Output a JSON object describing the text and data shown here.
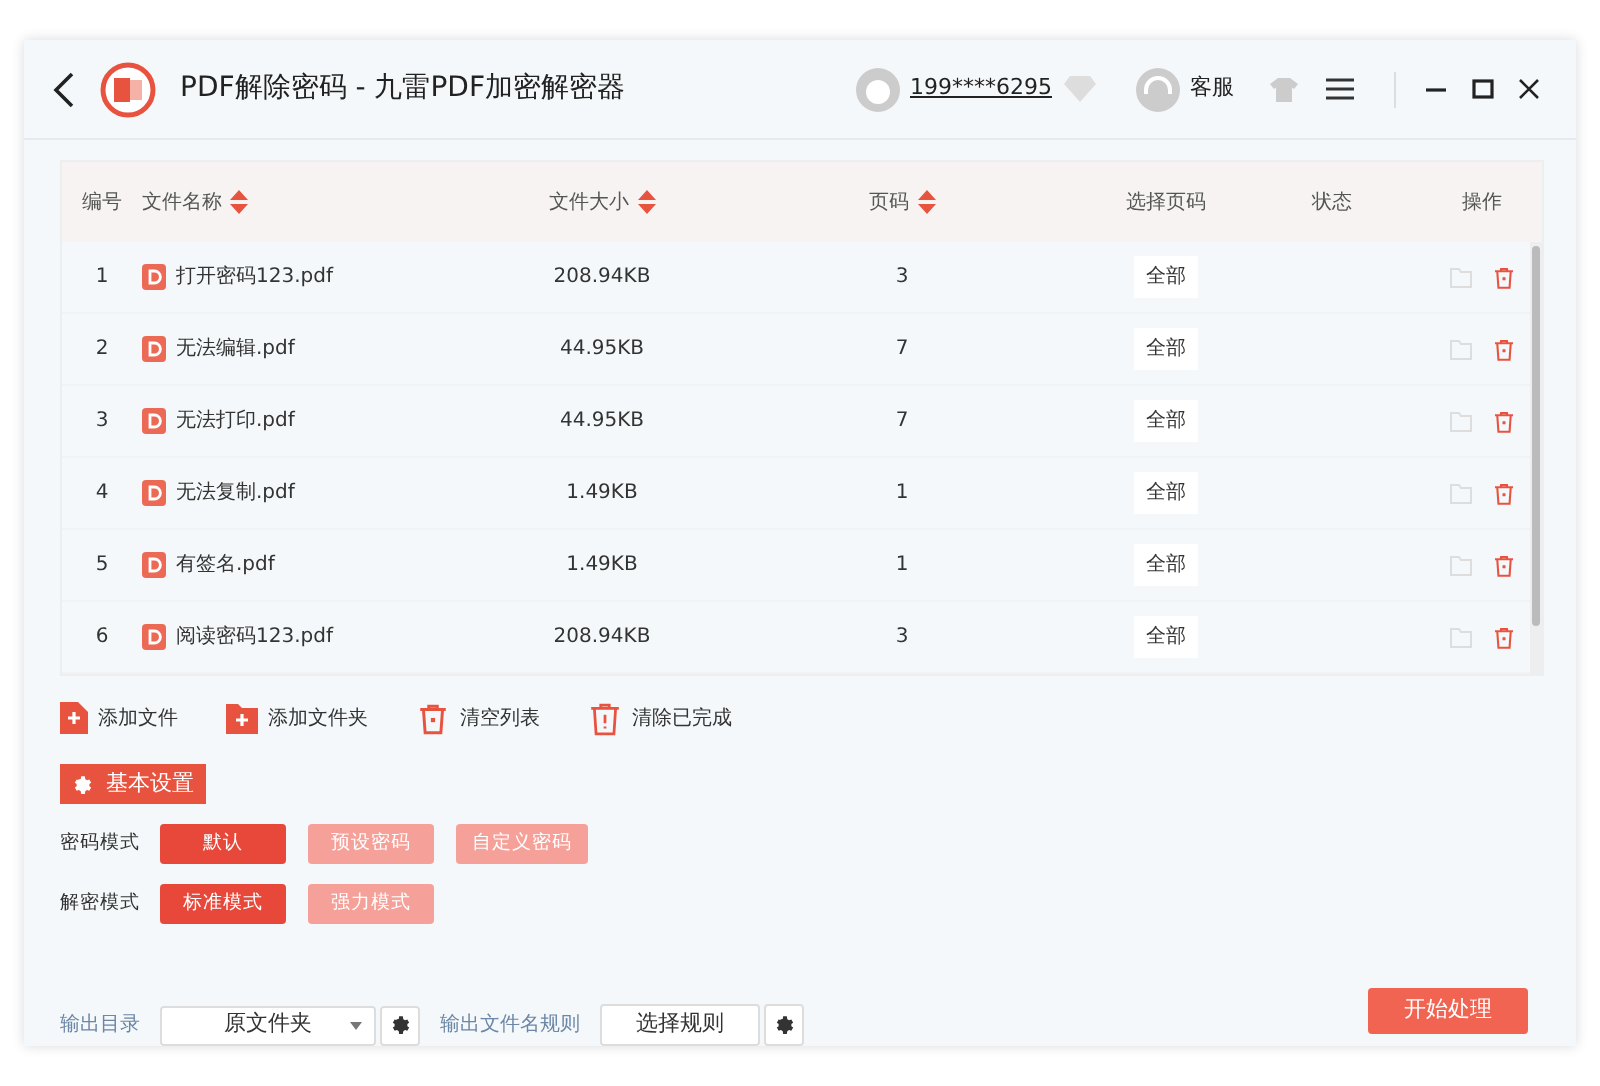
{
  "window": {
    "title": "PDF解除密码 - 九雷PDF加密解密器"
  },
  "account": {
    "user": "199****6295",
    "service": "客服"
  },
  "table": {
    "columns": [
      {
        "label": "编号",
        "sortable": false
      },
      {
        "label": "文件名称",
        "sortable": true
      },
      {
        "label": "文件大小",
        "sortable": true
      },
      {
        "label": "页码",
        "sortable": true
      },
      {
        "label": "选择页码",
        "sortable": false
      },
      {
        "label": "状态",
        "sortable": false
      },
      {
        "label": "操作",
        "sortable": false
      }
    ],
    "rows": [
      {
        "number": "1",
        "name": "打开密码123.pdf",
        "size": "208.94KB",
        "pages": "3",
        "page_select": "全部"
      },
      {
        "number": "2",
        "name": "无法编辑.pdf",
        "size": "44.95KB",
        "pages": "7",
        "page_select": "全部"
      },
      {
        "number": "3",
        "name": "无法打印.pdf",
        "size": "44.95KB",
        "pages": "7",
        "page_select": "全部"
      },
      {
        "number": "4",
        "name": "无法复制.pdf",
        "size": "1.49KB",
        "pages": "1",
        "page_select": "全部"
      },
      {
        "number": "5",
        "name": "有签名.pdf",
        "size": "1.49KB",
        "pages": "1",
        "page_select": "全部"
      },
      {
        "number": "6",
        "name": "阅读密码123.pdf",
        "size": "208.94KB",
        "pages": "3",
        "page_select": "全部"
      }
    ]
  },
  "toolbar": [
    {
      "kind": "add-file",
      "label": "添加文件"
    },
    {
      "kind": "add-folder",
      "label": "添加文件夹"
    },
    {
      "kind": "clear",
      "label": "清空列表"
    },
    {
      "kind": "clear-done",
      "label": "清除已完成"
    }
  ],
  "settings": {
    "title": "基本设置",
    "groups": [
      {
        "label": "密码模式",
        "options": [
          {
            "label": "默认",
            "selected": true
          },
          {
            "label": "预设密码",
            "selected": false
          },
          {
            "label": "自定义密码",
            "selected": false
          }
        ]
      },
      {
        "label": "解密模式",
        "options": [
          {
            "label": "标准模式",
            "selected": true
          },
          {
            "label": "强力模式",
            "selected": false
          }
        ]
      }
    ]
  },
  "output": {
    "dir_label": "输出目录",
    "dir_value": "原文件夹",
    "rule_label": "输出文件名规则",
    "rule_button": "选择规则"
  },
  "start_button": "开始处理"
}
